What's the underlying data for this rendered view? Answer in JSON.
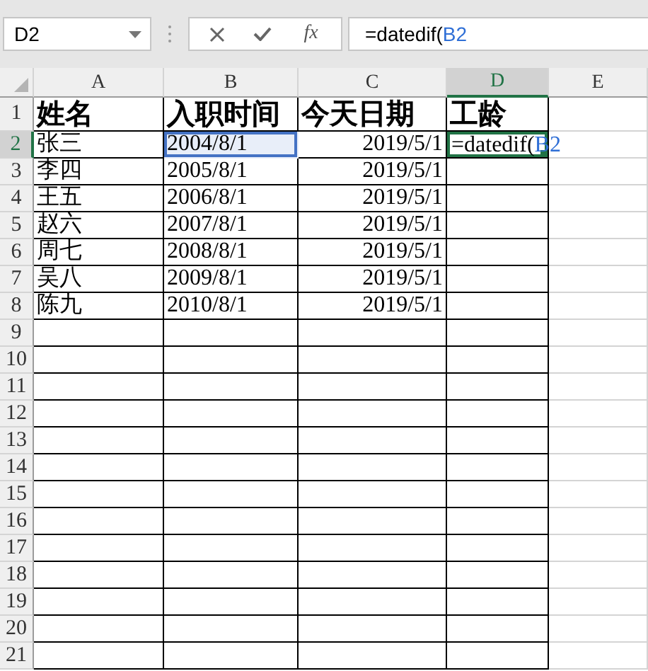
{
  "name_box": {
    "value": "D2"
  },
  "function_button": {
    "label": "fx"
  },
  "formula_bar": {
    "parts": [
      {
        "text": "=datedif(",
        "kind": "plain"
      },
      {
        "text": "B2",
        "kind": "reference"
      }
    ]
  },
  "columns": [
    {
      "label": "A",
      "selected": false
    },
    {
      "label": "B",
      "selected": false
    },
    {
      "label": "C",
      "selected": false
    },
    {
      "label": "D",
      "selected": true
    },
    {
      "label": "E",
      "selected": false
    }
  ],
  "rows": [
    {
      "label": "1",
      "selected": false,
      "cells": [
        {
          "text": "姓名",
          "referenced": false
        },
        {
          "text": "入职时间",
          "referenced": false
        },
        {
          "text": "今天日期",
          "referenced": false
        },
        {
          "text": "工龄",
          "referenced": false
        }
      ]
    },
    {
      "label": "2",
      "selected": true,
      "cells": [
        {
          "text": "张三",
          "referenced": false
        },
        {
          "text": "2004/8/1",
          "referenced": true
        },
        {
          "text": "2019/5/1",
          "referenced": false
        }
      ],
      "editing": [
        {
          "text": "=datedif(",
          "kind": "plain"
        },
        {
          "text": "B2",
          "kind": "reference"
        }
      ]
    },
    {
      "label": "3",
      "selected": false,
      "cells": [
        {
          "text": "李四",
          "referenced": false
        },
        {
          "text": "2005/8/1",
          "referenced": false
        },
        {
          "text": "2019/5/1",
          "referenced": false
        }
      ]
    },
    {
      "label": "4",
      "selected": false,
      "cells": [
        {
          "text": "王五",
          "referenced": false
        },
        {
          "text": "2006/8/1",
          "referenced": false
        },
        {
          "text": "2019/5/1",
          "referenced": false
        }
      ]
    },
    {
      "label": "5",
      "selected": false,
      "cells": [
        {
          "text": "赵六",
          "referenced": false
        },
        {
          "text": "2007/8/1",
          "referenced": false
        },
        {
          "text": "2019/5/1",
          "referenced": false
        }
      ]
    },
    {
      "label": "6",
      "selected": false,
      "cells": [
        {
          "text": "周七",
          "referenced": false
        },
        {
          "text": "2008/8/1",
          "referenced": false
        },
        {
          "text": "2019/5/1",
          "referenced": false
        }
      ]
    },
    {
      "label": "7",
      "selected": false,
      "cells": [
        {
          "text": "吴八",
          "referenced": false
        },
        {
          "text": "2009/8/1",
          "referenced": false
        },
        {
          "text": "2019/5/1",
          "referenced": false
        }
      ]
    },
    {
      "label": "8",
      "selected": false,
      "cells": [
        {
          "text": "陈九",
          "referenced": false
        },
        {
          "text": "2010/8/1",
          "referenced": false
        },
        {
          "text": "2019/5/1",
          "referenced": false
        }
      ]
    },
    {
      "label": "9",
      "selected": false
    },
    {
      "label": "10",
      "selected": false
    },
    {
      "label": "11",
      "selected": false
    },
    {
      "label": "12",
      "selected": false
    },
    {
      "label": "13",
      "selected": false
    },
    {
      "label": "14",
      "selected": false
    },
    {
      "label": "15",
      "selected": false
    },
    {
      "label": "16",
      "selected": false
    },
    {
      "label": "17",
      "selected": false
    },
    {
      "label": "18",
      "selected": false
    },
    {
      "label": "19",
      "selected": false
    },
    {
      "label": "20",
      "selected": false
    },
    {
      "label": "21",
      "selected": false
    }
  ]
}
